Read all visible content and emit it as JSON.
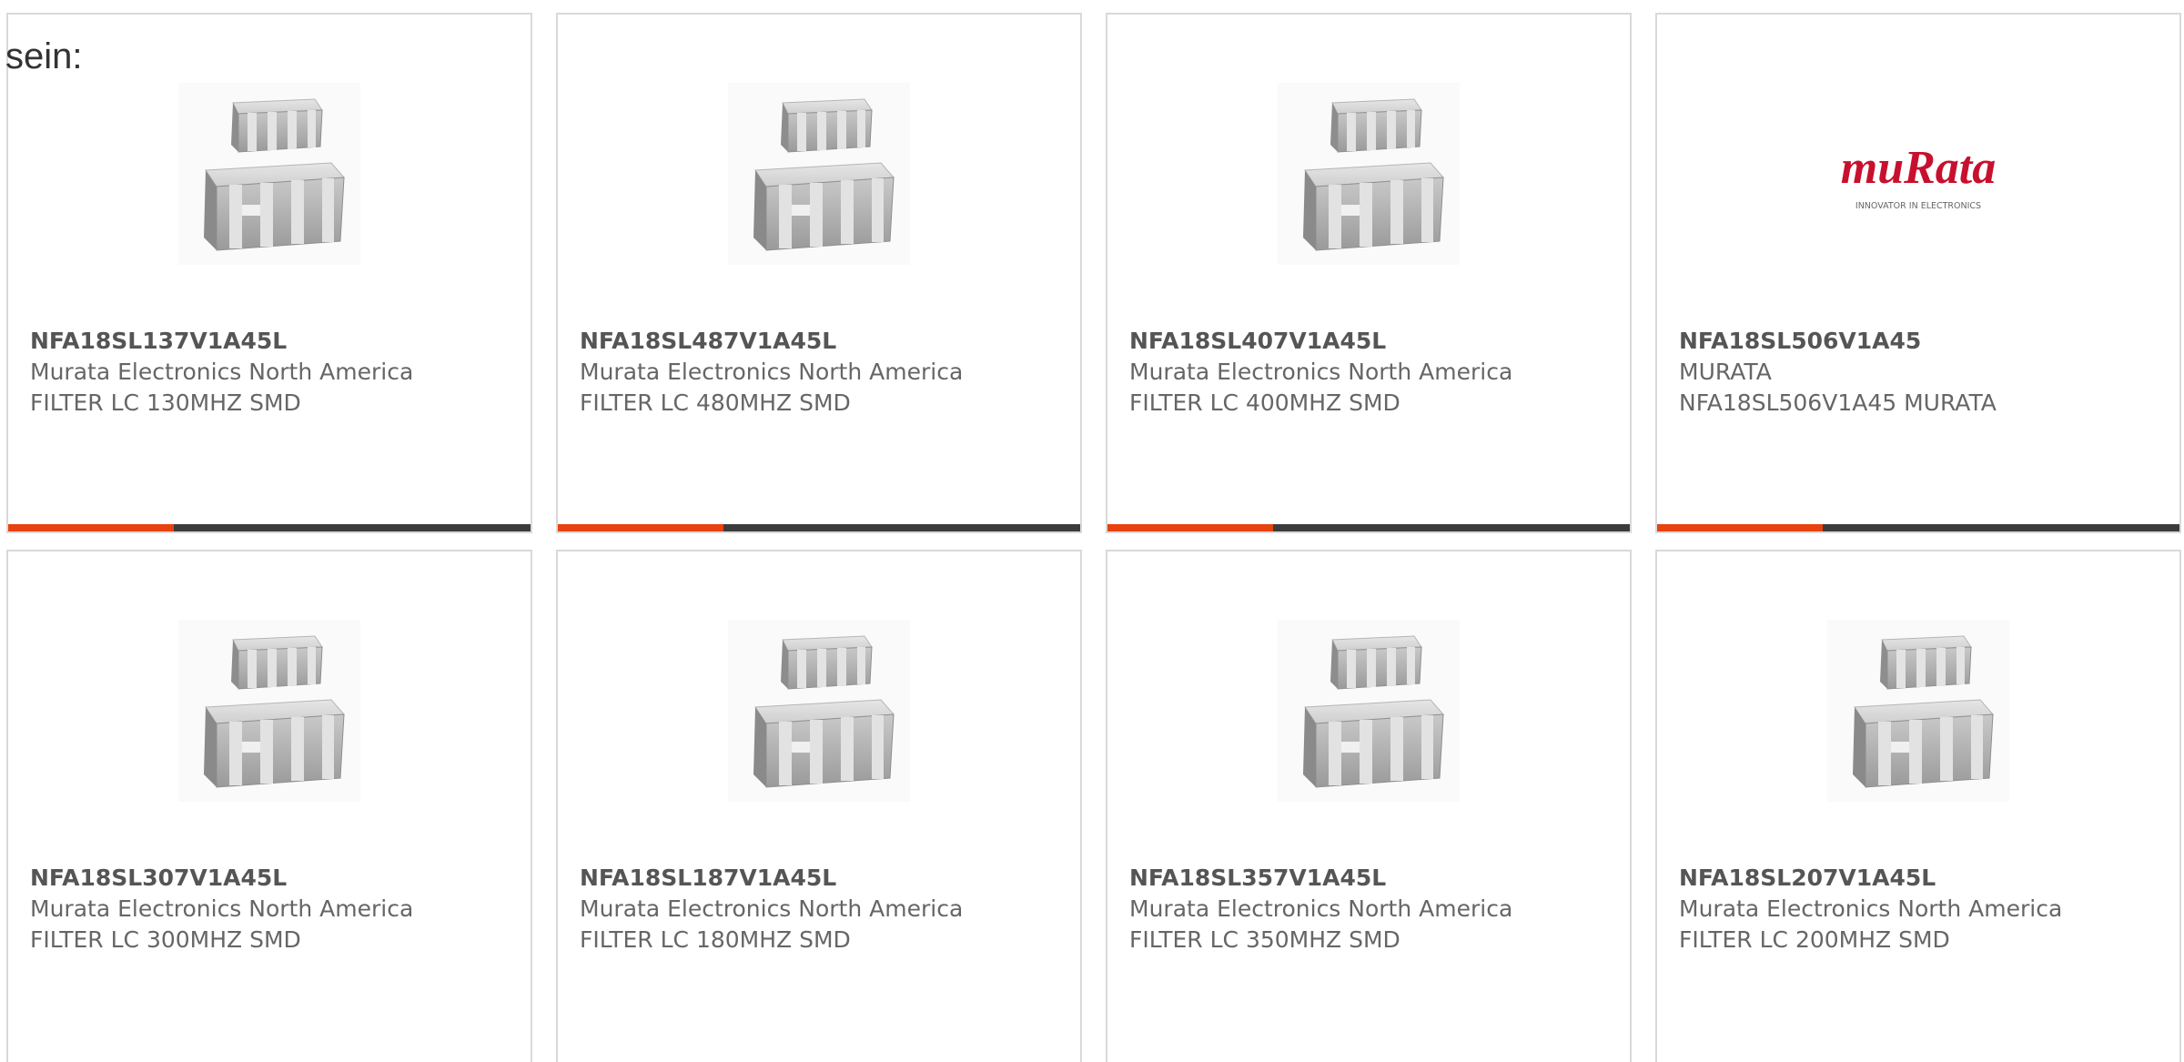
{
  "intro_text": "sein:",
  "colors": {
    "accent": "#e8420f",
    "bar": "#3c3c3c",
    "murata_red": "#c8102e"
  },
  "products": [
    {
      "part_number": "NFA18SL137V1A45L",
      "manufacturer": "Murata Electronics North America",
      "description": "FILTER LC 130MHZ SMD",
      "image": "smd-filter-chip"
    },
    {
      "part_number": "NFA18SL487V1A45L",
      "manufacturer": "Murata Electronics North America",
      "description": "FILTER LC 480MHZ SMD",
      "image": "smd-filter-chip"
    },
    {
      "part_number": "NFA18SL407V1A45L",
      "manufacturer": "Murata Electronics North America",
      "description": "FILTER LC 400MHZ SMD",
      "image": "smd-filter-chip"
    },
    {
      "part_number": "NFA18SL506V1A45",
      "manufacturer": "MURATA",
      "description": "NFA18SL506V1A45 MURATA",
      "image": "murata-logo",
      "logo_text": "muRata",
      "logo_tagline": "INNOVATOR IN ELECTRONICS"
    },
    {
      "part_number": "NFA18SL307V1A45L",
      "manufacturer": "Murata Electronics North America",
      "description": "FILTER LC 300MHZ SMD",
      "image": "smd-filter-chip"
    },
    {
      "part_number": "NFA18SL187V1A45L",
      "manufacturer": "Murata Electronics North America",
      "description": "FILTER LC 180MHZ SMD",
      "image": "smd-filter-chip"
    },
    {
      "part_number": "NFA18SL357V1A45L",
      "manufacturer": "Murata Electronics North America",
      "description": "FILTER LC 350MHZ SMD",
      "image": "smd-filter-chip"
    },
    {
      "part_number": "NFA18SL207V1A45L",
      "manufacturer": "Murata Electronics North America",
      "description": "FILTER LC 200MHZ SMD",
      "image": "smd-filter-chip"
    }
  ]
}
